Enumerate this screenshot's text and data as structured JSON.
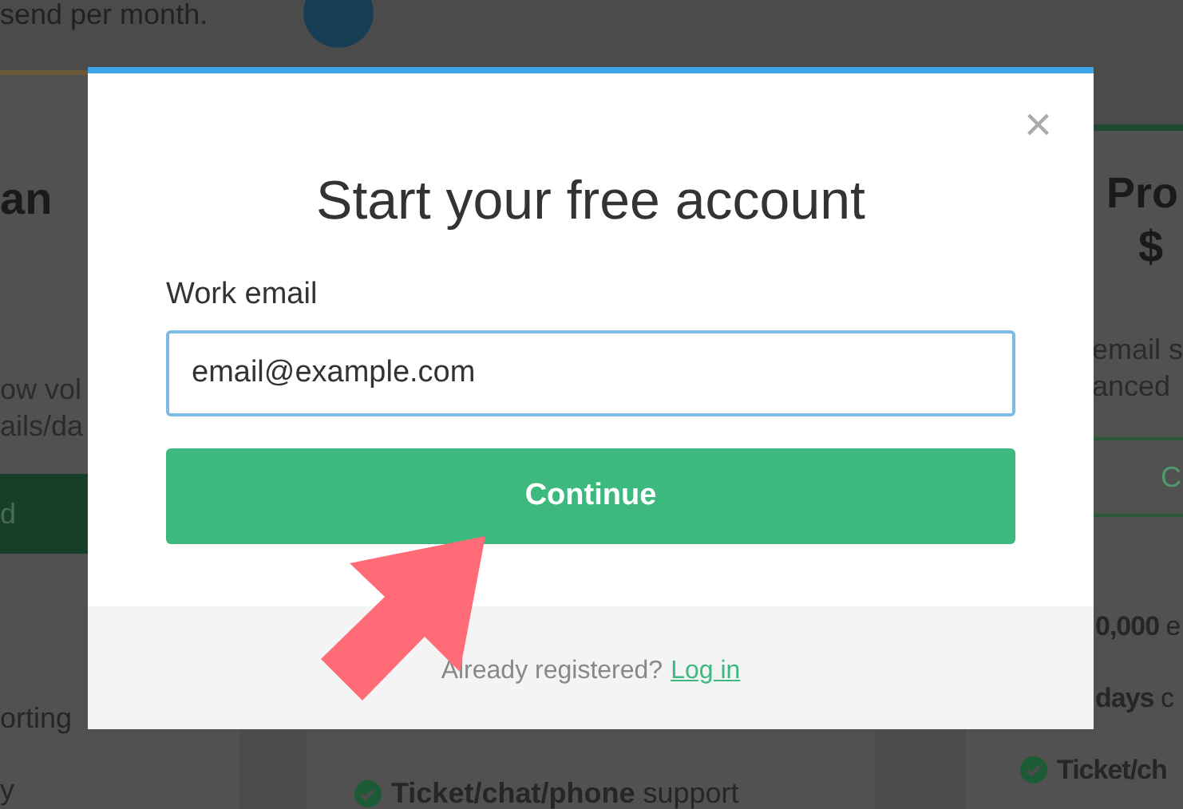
{
  "background": {
    "top_text": "send per month.",
    "left_card": {
      "title": "an",
      "description": [
        "ow vol",
        "ails/da"
      ],
      "button": "d",
      "features": [
        "orting",
        "y"
      ]
    },
    "middle_card": {
      "features": [
        "**Ticket/chat/phone** support"
      ]
    },
    "right_card": {
      "title": "Pro",
      "price": "$",
      "description": [
        "email s",
        "anced"
      ],
      "button": "C",
      "features": [
        {
          "kind": "partial",
          "text": "**0,000** e"
        },
        {
          "kind": "partial",
          "text": "**days** c"
        },
        {
          "kind": "full",
          "text": "**Ticket/ch**"
        }
      ]
    }
  },
  "modal": {
    "close": "×",
    "title": "Start your free account",
    "email_label": "Work email",
    "email_value": "email@example.com",
    "submit": "Continue",
    "footer_text": "Already registered?",
    "footer_link": "Log in"
  }
}
